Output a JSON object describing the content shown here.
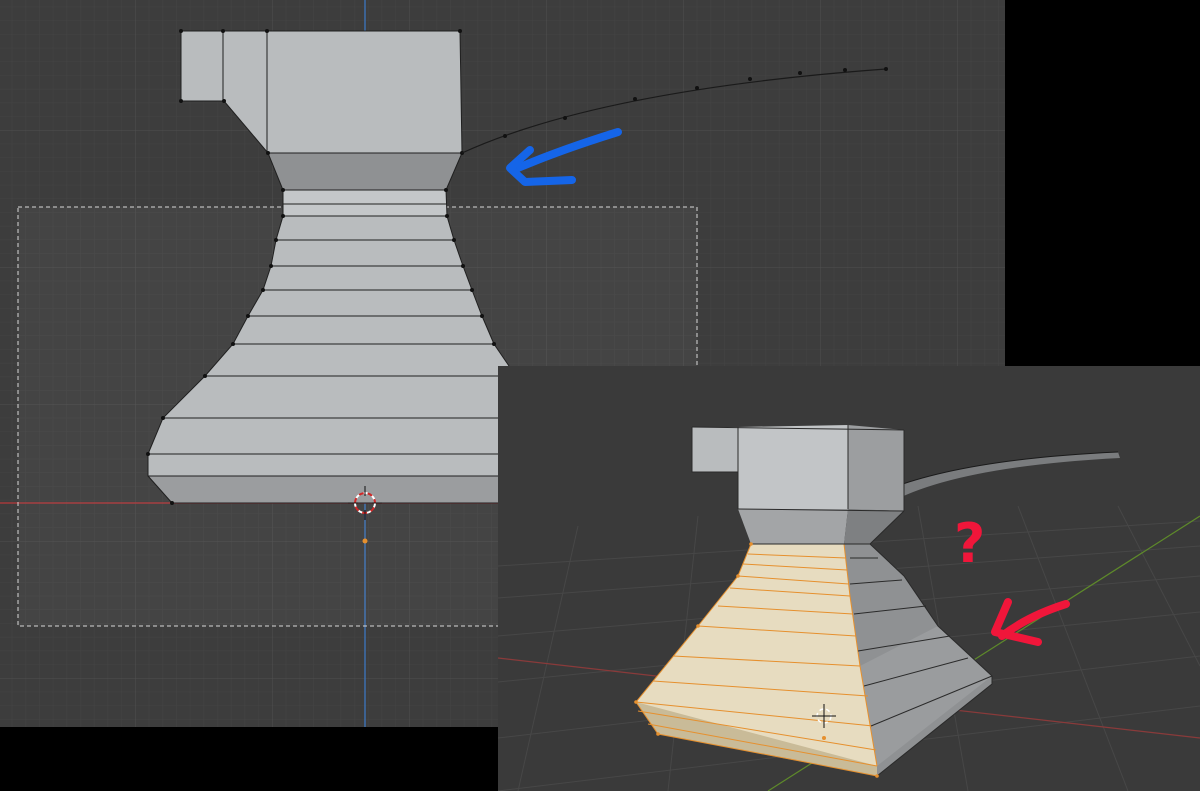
{
  "front_viewport": {
    "view": "front-orthographic",
    "grid": true,
    "box_select_active": true,
    "annotation_arrow": {
      "color": "#1565e8",
      "points_to": "bezier-curve-start"
    }
  },
  "perspective_viewport": {
    "view": "user-perspective",
    "grid": true,
    "selection_color": "#e6902e",
    "annotation": {
      "question_mark": "?",
      "arrow_color": "#f0163a"
    }
  },
  "colors": {
    "viewport_bg": "#3d3d3d",
    "mesh_face": "#b9bcbe",
    "mesh_shadow": "#8e9092",
    "selected_face": "#e7dcc0",
    "x_axis": "#a4393b",
    "z_axis": "#3d6fae",
    "y_axis": "#5e8a2a"
  }
}
